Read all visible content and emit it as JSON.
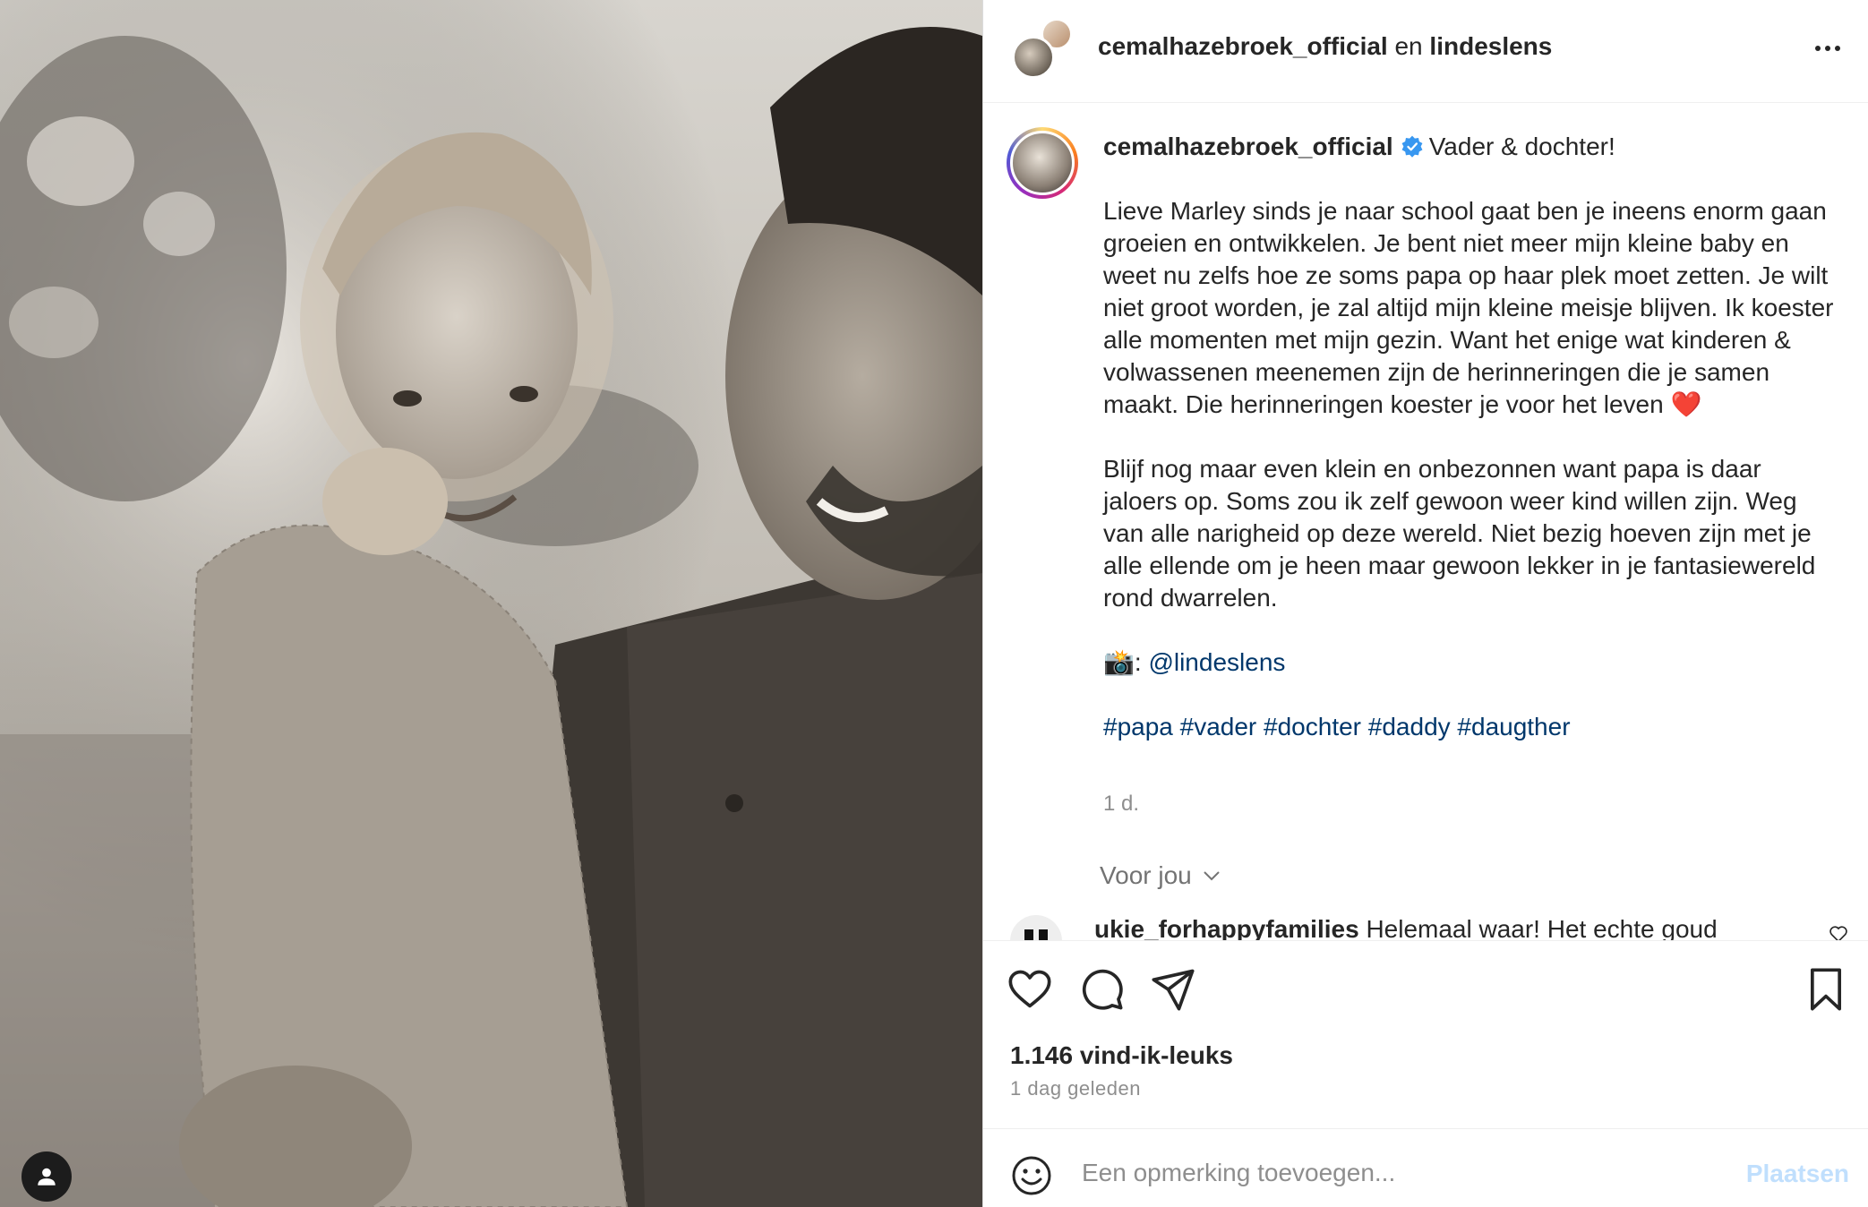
{
  "header": {
    "username": "cemalhazebroek_official",
    "connector": "en",
    "collaborator": "lindeslens",
    "more_icon": "more-horizontal-icon"
  },
  "caption": {
    "username": "cemalhazebroek_official",
    "verified": true,
    "title": "Vader & dochter!",
    "paragraph1": "Lieve Marley sinds je naar school gaat ben je ineens enorm gaan groeien en ontwikkelen. Je bent niet meer mijn kleine baby en weet nu zelfs hoe ze soms papa op haar plek moet zetten. Je wilt niet groot worden, je zal altijd mijn kleine meisje blijven. Ik koester alle momenten met mijn gezin. Want het enige wat kinderen & volwassenen meenemen zijn de herinneringen die je samen maakt. Die herinneringen koester je voor het leven",
    "paragraph1_emoji": "❤️",
    "paragraph2": "Blijf nog maar even klein en onbezonnen want papa is daar jaloers op. Soms zou ik zelf gewoon weer kind willen zijn. Weg van alle narigheid op deze wereld. Niet bezig hoeven zijn met je alle ellende om je heen maar gewoon lekker in je fantasiewereld rond dwarrelen.",
    "credit_emoji": "📸",
    "credit_sep": ":",
    "credit_mention": "@lindeslens",
    "hashtags": "#papa #vader #dochter #daddy #daugther",
    "time": "1 d."
  },
  "for_you": "Voor jou",
  "first_comment": {
    "username": "ukie_forhappyfamilies",
    "text": "Helemaal waar! Het echte goud"
  },
  "likes": "1.146 vind-ik-leuks",
  "posted_ago": "1 dag geleden",
  "comment_input": {
    "placeholder": "Een opmerking toevoegen...",
    "post_label": "Plaatsen"
  },
  "colors": {
    "link": "#00376b",
    "verified": "#3897f0",
    "post_disabled": "#c0dffd",
    "muted": "#8e8e8e"
  }
}
